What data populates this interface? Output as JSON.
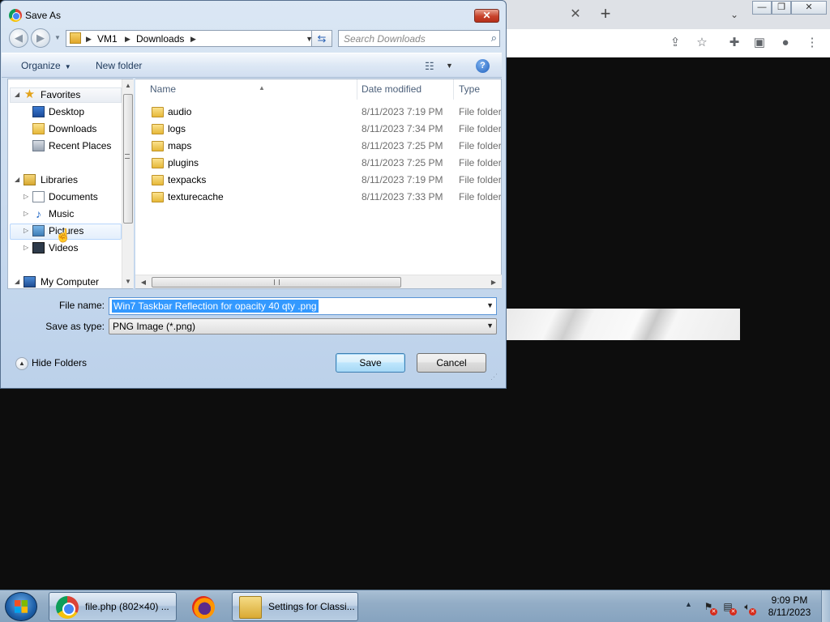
{
  "browser": {
    "toolbar_icons": [
      "share-icon",
      "bookmark-star-icon",
      "extensions-icon",
      "side-panel-icon",
      "profile-icon",
      "menu-icon"
    ]
  },
  "dialog": {
    "title": "Save As",
    "address": {
      "crumbs": [
        "VM1",
        "Downloads"
      ]
    },
    "search_placeholder": "Search Downloads",
    "commands": {
      "organize": "Organize",
      "new_folder": "New folder"
    },
    "nav_tree": {
      "favorites": "Favorites",
      "desktop": "Desktop",
      "downloads": "Downloads",
      "recent_places": "Recent Places",
      "libraries": "Libraries",
      "documents": "Documents",
      "music": "Music",
      "pictures": "Pictures",
      "videos": "Videos",
      "my_computer": "My Computer"
    },
    "columns": {
      "name": "Name",
      "date_modified": "Date modified",
      "type": "Type"
    },
    "files": [
      {
        "name": "audio",
        "date": "8/11/2023 7:19 PM",
        "type": "File folder"
      },
      {
        "name": "logs",
        "date": "8/11/2023 7:34 PM",
        "type": "File folder"
      },
      {
        "name": "maps",
        "date": "8/11/2023 7:25 PM",
        "type": "File folder"
      },
      {
        "name": "plugins",
        "date": "8/11/2023 7:25 PM",
        "type": "File folder"
      },
      {
        "name": "texpacks",
        "date": "8/11/2023 7:19 PM",
        "type": "File folder"
      },
      {
        "name": "texturecache",
        "date": "8/11/2023 7:33 PM",
        "type": "File folder"
      }
    ],
    "file_name_label": "File name:",
    "file_name_value": "Win7 Taskbar Reflection for opacity 40 qty .png",
    "save_type_label": "Save as type:",
    "save_type_value": "PNG Image (*.png)",
    "hide_folders": "Hide Folders",
    "save_button": "Save",
    "cancel_button": "Cancel"
  },
  "taskbar": {
    "tasks": [
      {
        "label": "file.php (802×40) ...",
        "icon": "chrome-icon"
      },
      {
        "label": "",
        "icon": "firefox-icon"
      },
      {
        "label": "Settings for Classi...",
        "icon": "settings-folder-icon"
      }
    ],
    "clock_time": "9:09 PM",
    "clock_date": "8/11/2023"
  },
  "colors": {
    "selection": "#3399ff",
    "dialog_frame": "#c7d9ee",
    "close_button": "#c7412a",
    "taskbar": "#93adc6"
  }
}
